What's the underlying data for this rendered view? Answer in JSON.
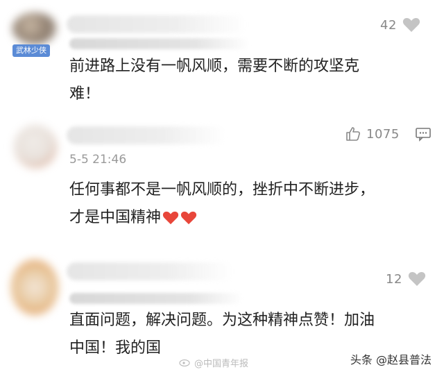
{
  "comments": [
    {
      "badge": "武林少侠",
      "likes": "42",
      "text_line1": "前进路上没有一帆风顺，需要不断的攻坚克",
      "text_line2": "难！"
    },
    {
      "likes": "1075",
      "time": "5-5 21:46",
      "text_line1": "任何事都不是一帆风顺的，挫折中不断进步，",
      "text_line2": "才是中国精神"
    },
    {
      "likes": "12",
      "text_line1": "直面问题，解决问题。为这种精神点赞！加油",
      "text_line2": "中国！我的国"
    }
  ],
  "watermark": {
    "left": "@中国青年报",
    "right": "头条 @赵县普法"
  },
  "colors": {
    "heart_gray": "#c4c4c4",
    "heart_red": "#e8463a",
    "badge_blue": "#5b8bd6"
  }
}
